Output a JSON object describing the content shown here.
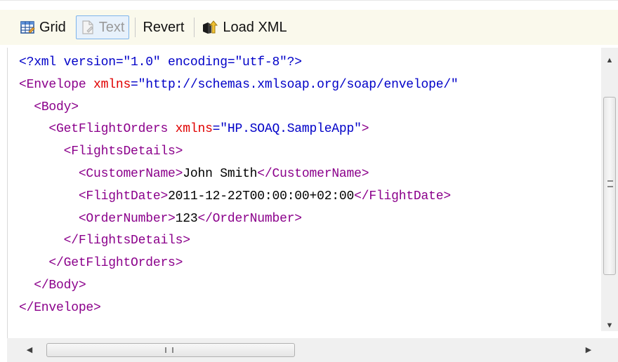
{
  "toolbar": {
    "grid_label": "Grid",
    "text_label": "Text",
    "revert_label": "Revert",
    "load_label": "Load XML",
    "icons": [
      "grid-icon",
      "text-icon",
      "load-xml-icon"
    ]
  },
  "editor": {
    "lines": [
      {
        "indent": "",
        "parts": [
          {
            "t": "pi",
            "v": "<?xml version=\"1.0\" encoding=\"utf-8\"?>"
          }
        ]
      },
      {
        "indent": "",
        "parts": [
          {
            "t": "tag",
            "v": "<Envelope "
          },
          {
            "t": "attr",
            "v": "xmlns"
          },
          {
            "t": "val",
            "v": "=\"http://schemas.xmlsoap.org/soap/envelope/\""
          }
        ]
      },
      {
        "indent": "  ",
        "parts": [
          {
            "t": "tag",
            "v": "<Body>"
          }
        ]
      },
      {
        "indent": "    ",
        "parts": [
          {
            "t": "tag",
            "v": "<GetFlightOrders "
          },
          {
            "t": "attr",
            "v": "xmlns"
          },
          {
            "t": "val",
            "v": "=\"HP.SOAQ.SampleApp\""
          },
          {
            "t": "tag",
            "v": ">"
          }
        ]
      },
      {
        "indent": "      ",
        "parts": [
          {
            "t": "tag",
            "v": "<FlightsDetails>"
          }
        ]
      },
      {
        "indent": "        ",
        "parts": [
          {
            "t": "tag",
            "v": "<CustomerName>"
          },
          {
            "t": "txt",
            "v": "John Smith"
          },
          {
            "t": "tag",
            "v": "</CustomerName>"
          }
        ]
      },
      {
        "indent": "        ",
        "parts": [
          {
            "t": "tag",
            "v": "<FlightDate>"
          },
          {
            "t": "txt",
            "v": "2011-12-22T00:00:00+02:00"
          },
          {
            "t": "tag",
            "v": "</FlightDate>"
          }
        ]
      },
      {
        "indent": "        ",
        "parts": [
          {
            "t": "tag",
            "v": "<OrderNumber>"
          },
          {
            "t": "txt",
            "v": "123"
          },
          {
            "t": "tag",
            "v": "</OrderNumber>"
          }
        ]
      },
      {
        "indent": "      ",
        "parts": [
          {
            "t": "tag",
            "v": "</FlightsDetails>"
          }
        ]
      },
      {
        "indent": "    ",
        "parts": [
          {
            "t": "tag",
            "v": "</GetFlightOrders>"
          }
        ]
      },
      {
        "indent": "  ",
        "parts": [
          {
            "t": "tag",
            "v": "</Body>"
          }
        ]
      },
      {
        "indent": "",
        "parts": [
          {
            "t": "tag",
            "v": "</Envelope>"
          }
        ]
      }
    ]
  },
  "scrollbars": {
    "vertical_grip": "≡",
    "horizontal_grip": "III"
  },
  "colors": {
    "tag": "#8b008b",
    "attribute": "#e00000",
    "value": "#0000c8",
    "text": "#000000",
    "toolbar_bg": "#faf9ec"
  }
}
